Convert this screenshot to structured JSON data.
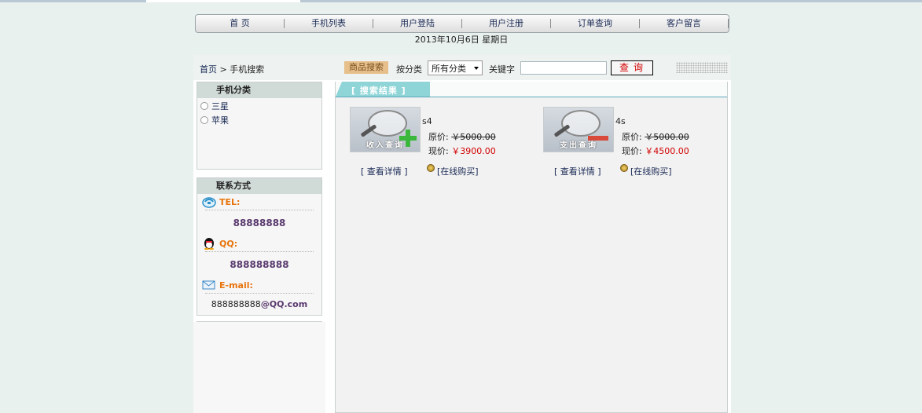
{
  "nav": {
    "items": [
      "首 页",
      "手机列表",
      "用户登陆",
      "用户注册",
      "订单查询",
      "客户留言"
    ]
  },
  "date": "2013年10月6日  星期日",
  "breadcrumb": {
    "home": "首页",
    "sep": " > ",
    "current": "手机搜索"
  },
  "search": {
    "tag": "商品搜索",
    "category_label": "按分类",
    "category_value": "所有分类",
    "keyword_label": "关键字",
    "keyword_value": "",
    "button": "查询"
  },
  "categories": {
    "title": "手机分类",
    "items": [
      "三星",
      "苹果"
    ]
  },
  "contact": {
    "title": "联系方式",
    "tel_label": "TEL:",
    "tel": "88888888",
    "qq_label": "QQ:",
    "qq": "888888888",
    "email_label": "E-mail:",
    "email_user": "888888888",
    "email_domain": "@QQ.com"
  },
  "results": {
    "title": "[ 搜索结果 ]",
    "products": [
      {
        "name": "s4",
        "orig_label": "原价:",
        "orig": "￥5000.00",
        "now_label": "现价:",
        "now": "￥3900.00",
        "detail": "[ 查看详情 ]",
        "buy": "[在线购买]",
        "image_caption": "收入查询"
      },
      {
        "name": "4s",
        "orig_label": "原价:",
        "orig": "￥5000.00",
        "now_label": "现价:",
        "now": "￥4500.00",
        "detail": "[ 查看详情 ]",
        "buy": "[在线购买]",
        "image_caption": "支出查询"
      }
    ]
  },
  "colors": {
    "accent_red": "#d20000",
    "tab_teal": "#8fd5d8",
    "contact_orange": "#e8740c"
  }
}
